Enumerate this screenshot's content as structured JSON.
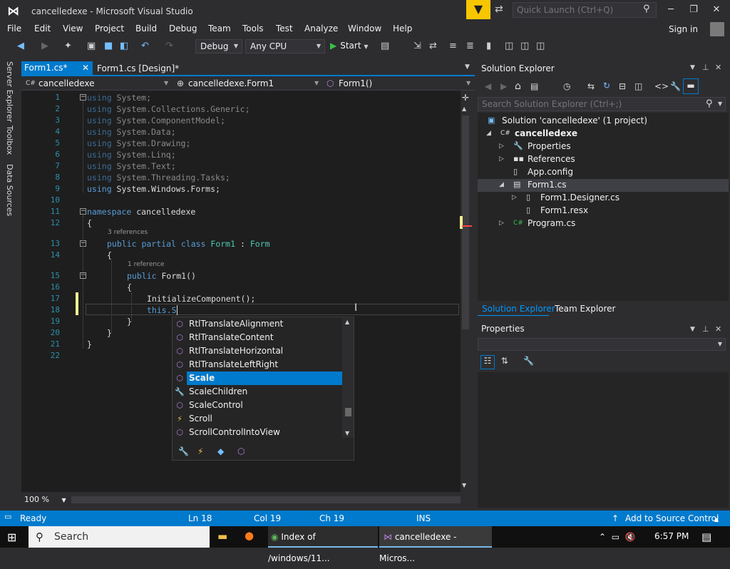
{
  "window": {
    "title": "cancelledexe - Microsoft Visual Studio",
    "quick_launch_placeholder": "Quick Launch (Ctrl+Q)",
    "sign_in": "Sign in"
  },
  "menu": [
    "File",
    "Edit",
    "View",
    "Project",
    "Build",
    "Debug",
    "Team",
    "Tools",
    "Test",
    "Analyze",
    "Window",
    "Help"
  ],
  "toolbar": {
    "config": "Debug",
    "platform": "Any CPU",
    "start_label": "Start"
  },
  "left_tabs": [
    "Server Explorer",
    "Toolbox",
    "Data Sources"
  ],
  "doc_tabs": {
    "active": "Form1.cs*",
    "design": "Form1.cs [Design]*"
  },
  "navbar": {
    "project": "cancelledexe",
    "class": "cancelledexe.Form1",
    "member": "Form1()"
  },
  "code": {
    "line_numbers": [
      "1",
      "2",
      "3",
      "4",
      "5",
      "6",
      "7",
      "8",
      "9",
      "10",
      "11",
      "12",
      "13",
      "14",
      "15",
      "16",
      "17",
      "18",
      "19",
      "20",
      "21",
      "22"
    ],
    "usings": [
      "System",
      "System.Collections.Generic",
      "System.ComponentModel",
      "System.Data",
      "System.Drawing",
      "System.Linq",
      "System.Text",
      "System.Threading.Tasks",
      "System.Windows.Forms"
    ],
    "namespace_name": "cancelledexe",
    "class_refs": "3 references",
    "class_decl_name": "Form1",
    "base_type": "Form",
    "ctor_refs": "1 reference",
    "ctor_name": "Form1()",
    "init_call": "InitializeComponent();",
    "typing": "this.S"
  },
  "zoom": "100 %",
  "intellisense": {
    "items": [
      {
        "label": "RtlTranslateAlignment",
        "icon": "method-icon"
      },
      {
        "label": "RtlTranslateContent",
        "icon": "method-icon"
      },
      {
        "label": "RtlTranslateHorizontal",
        "icon": "method-icon"
      },
      {
        "label": "RtlTranslateLeftRight",
        "icon": "method-icon"
      },
      {
        "label": "Scale",
        "icon": "method-icon"
      },
      {
        "label": "ScaleChildren",
        "icon": "property-icon"
      },
      {
        "label": "ScaleControl",
        "icon": "method-icon"
      },
      {
        "label": "Scroll",
        "icon": "event-icon"
      },
      {
        "label": "ScrollControlIntoView",
        "icon": "method-icon"
      }
    ],
    "selected_index": 4
  },
  "solution_explorer": {
    "title": "Solution Explorer",
    "search_placeholder": "Search Solution Explorer (Ctrl+;)",
    "tree": [
      {
        "label": "Solution 'cancelledexe' (1 project)",
        "level": 0
      },
      {
        "label": "cancelledexe",
        "level": 1
      },
      {
        "label": "Properties",
        "level": 2
      },
      {
        "label": "References",
        "level": 2
      },
      {
        "label": "App.config",
        "level": 2
      },
      {
        "label": "Form1.cs",
        "level": 2
      },
      {
        "label": "Form1.Designer.cs",
        "level": 3
      },
      {
        "label": "Form1.resx",
        "level": 3
      },
      {
        "label": "Program.cs",
        "level": 2
      }
    ],
    "tabs": [
      "Solution Explorer",
      "Team Explorer"
    ]
  },
  "properties": {
    "title": "Properties"
  },
  "status": {
    "state": "Ready",
    "line": "Ln 18",
    "col": "Col 19",
    "ch": "Ch 19",
    "mode": "INS",
    "source_control": "Add to Source Control"
  },
  "taskbar": {
    "search": "Search",
    "chrome_title": "Index of /windows/11...",
    "vs_title": "cancelledexe - Micros...",
    "time": "6:57 PM"
  }
}
